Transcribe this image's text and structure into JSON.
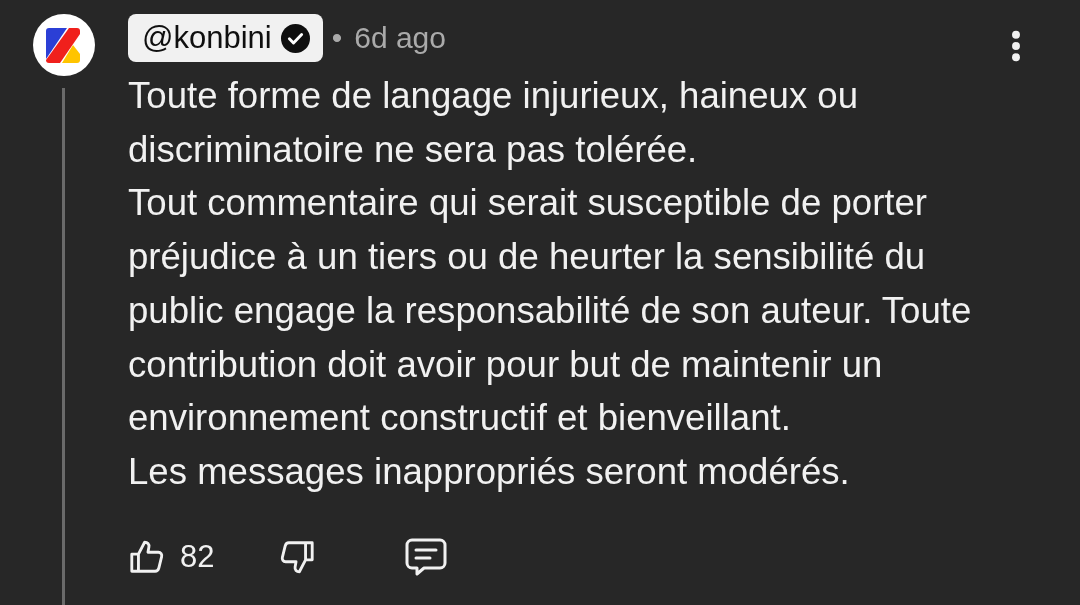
{
  "author": {
    "handle": "@konbini",
    "verified": true
  },
  "separator": "•",
  "time": "6d ago",
  "comment": {
    "paragraphs": [
      "Toute forme de langage injurieux, haineux ou discriminatoire ne sera pas tolérée.",
      "Tout commentaire qui serait susceptible de porter préjudice à un tiers ou de heurter la sensibilité du public engage la responsabilité de son auteur. Toute contribution doit avoir pour but de maintenir un environnement constructif et bienveillant.",
      "Les messages inappropriés seront modérés."
    ]
  },
  "actions": {
    "likes": "82",
    "liked": false,
    "disliked": false
  }
}
